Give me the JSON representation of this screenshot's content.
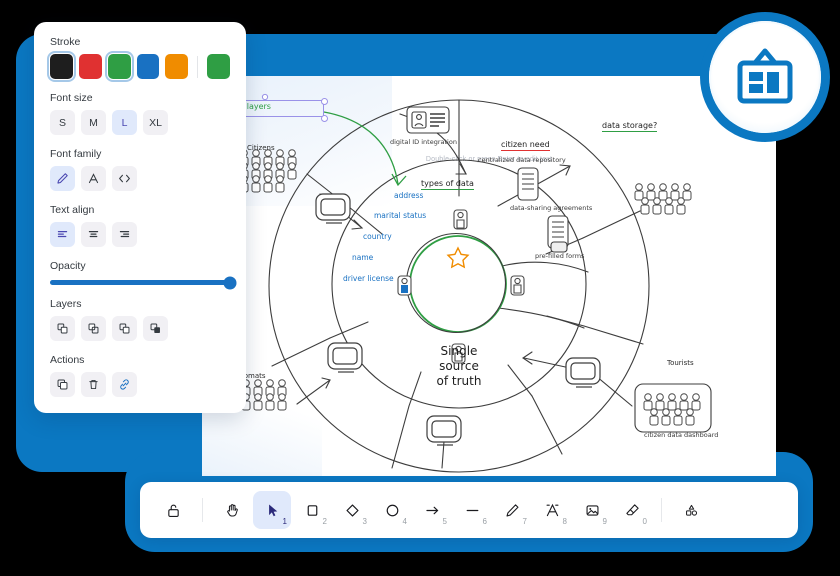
{
  "app": {
    "logo_icon": "whiteboard-icon",
    "canvas_hint": "Double-click or press Enter to edit text"
  },
  "panel": {
    "sections": {
      "stroke": "Stroke",
      "font_size": "Font size",
      "font_family": "Font family",
      "text_align": "Text align",
      "opacity": "Opacity",
      "layers": "Layers",
      "actions": "Actions"
    },
    "stroke_colors": [
      {
        "name": "black",
        "hex": "#1e1e1e",
        "selected": false
      },
      {
        "name": "red",
        "hex": "#e03131",
        "selected": false
      },
      {
        "name": "green",
        "hex": "#2f9e44",
        "selected": true
      },
      {
        "name": "blue",
        "hex": "#1971c2",
        "selected": false
      },
      {
        "name": "orange",
        "hex": "#f08c00",
        "selected": false
      }
    ],
    "current_stroke": {
      "name": "current-green",
      "hex": "#2f9e44"
    },
    "font_sizes": [
      {
        "label": "S",
        "selected": false
      },
      {
        "label": "M",
        "selected": false
      },
      {
        "label": "L",
        "selected": true
      },
      {
        "label": "XL",
        "selected": false
      }
    ],
    "font_families": [
      {
        "icon": "hand-drawn-pen-icon",
        "selected": true
      },
      {
        "icon": "normal-font-a-icon",
        "selected": false
      },
      {
        "icon": "code-font-icon",
        "selected": false
      }
    ],
    "text_aligns": [
      {
        "icon": "align-left-icon",
        "selected": true
      },
      {
        "icon": "align-center-icon",
        "selected": false
      },
      {
        "icon": "align-right-icon",
        "selected": false
      }
    ],
    "opacity": {
      "value": 100,
      "fill_percent": 100
    },
    "layers": [
      {
        "icon": "send-to-back-icon"
      },
      {
        "icon": "send-backward-icon"
      },
      {
        "icon": "bring-forward-icon"
      },
      {
        "icon": "bring-to-front-icon"
      }
    ],
    "actions": [
      {
        "icon": "duplicate-icon"
      },
      {
        "icon": "delete-icon"
      },
      {
        "icon": "link-icon"
      }
    ]
  },
  "toolbar": {
    "items": [
      {
        "icon": "lock-icon",
        "key": "",
        "active": false
      },
      {
        "icon": "hand-icon",
        "key": "",
        "active": false
      },
      {
        "icon": "selection-icon",
        "key": "1",
        "active": true
      },
      {
        "icon": "rectangle-icon",
        "key": "2",
        "active": false
      },
      {
        "icon": "diamond-icon",
        "key": "3",
        "active": false
      },
      {
        "icon": "ellipse-icon",
        "key": "4",
        "active": false
      },
      {
        "icon": "arrow-icon",
        "key": "5",
        "active": false
      },
      {
        "icon": "line-icon",
        "key": "6",
        "active": false
      },
      {
        "icon": "draw-pencil-icon",
        "key": "7",
        "active": false
      },
      {
        "icon": "text-icon",
        "key": "8",
        "active": false
      },
      {
        "icon": "image-icon",
        "key": "9",
        "active": false
      },
      {
        "icon": "eraser-icon",
        "key": "0",
        "active": false
      },
      {
        "icon": "shape-library-icon",
        "key": "",
        "active": false
      }
    ]
  },
  "diagram": {
    "center_line1": "Single",
    "center_line2": "source",
    "center_line3": "of truth",
    "center_star_icon": "star-icon",
    "selected_text": "a sensitivity layers",
    "headings": [
      {
        "text": "types of data",
        "underline": "green"
      },
      {
        "text": "citizen need",
        "underline": "red"
      },
      {
        "text": "data storage?",
        "underline": "green"
      }
    ],
    "data_types": [
      "address",
      "marital status",
      "country",
      "name",
      "driver license"
    ],
    "node_labels": [
      "digital ID integration",
      "centralized data repository",
      "data-sharing agreements",
      "pre-filled forms",
      "citizen data dashboard"
    ],
    "group_labels": [
      "Citizens",
      "Diplomats",
      "Tourists"
    ]
  }
}
